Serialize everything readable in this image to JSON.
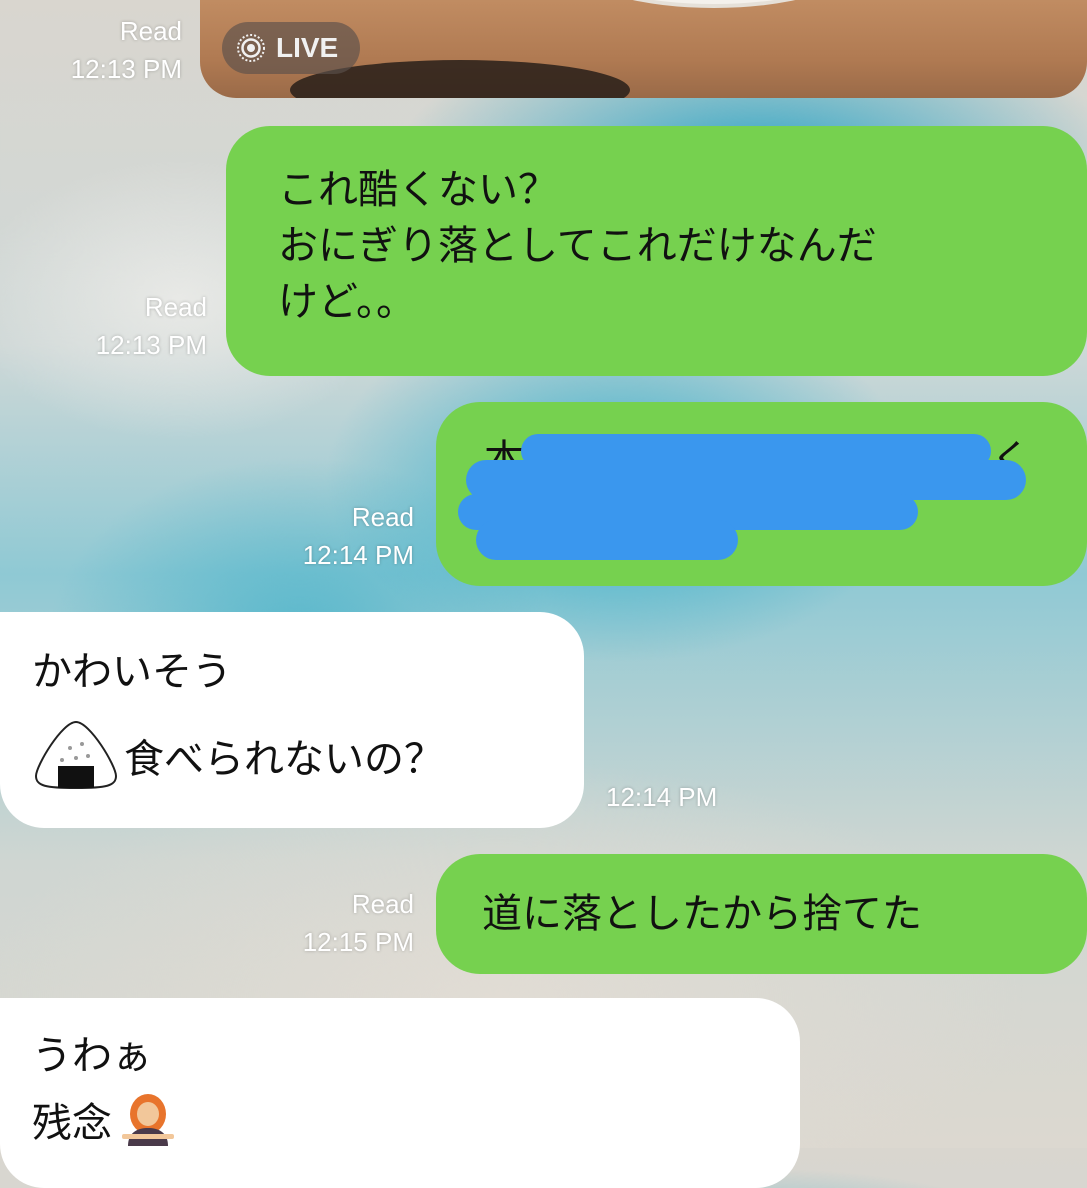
{
  "top_photo": {
    "badge": "LIVE"
  },
  "messages": [
    {
      "meta_read": "Read",
      "time": "12:13 PM"
    },
    {
      "lines": [
        "これ酷くない？",
        "おにぎり落としてこれだけなんだ",
        "けど。。"
      ],
      "meta_read": "Read",
      "time": "12:13 PM"
    },
    {
      "lines": [
        "本",
        "く"
      ],
      "meta_read": "Read",
      "time": "12:14 PM",
      "redacted": true
    },
    {
      "lines": [
        "かわいそう",
        "食べられないの？"
      ],
      "time": "12:14 PM",
      "icon": "onigiri-emoji"
    },
    {
      "lines": [
        "道に落としたから捨てた"
      ],
      "meta_read": "Read",
      "time": "12:15 PM"
    },
    {
      "lines": [
        "うわぁ",
        "残念"
      ],
      "icon": "woman-shrugging-emoji"
    }
  ],
  "colors": {
    "outgoing": "#76d14f",
    "incoming": "#ffffff",
    "redaction": "#3a97ee"
  }
}
